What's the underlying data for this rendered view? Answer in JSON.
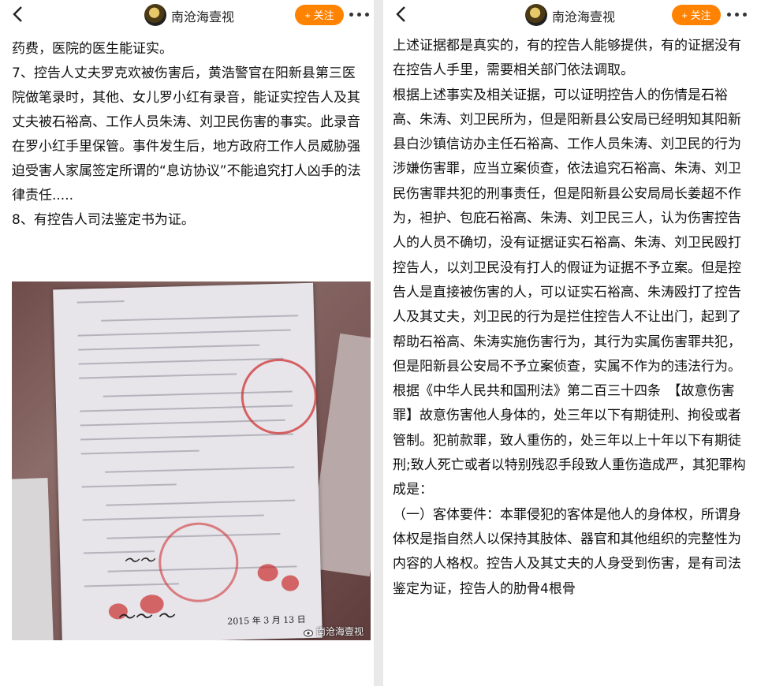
{
  "left": {
    "header": {
      "account_name": "南沧海壹视",
      "follow_label": "+ 关注"
    },
    "paragraphs": [
      "药费，医院的医生能证实。",
      "7、控告人丈夫罗克欢被伤害后，黄浩警官在阳新县第三医院做笔录时，其他、女儿罗小红有录音，能证实控告人及其丈夫被石裕高、工作人员朱涛、刘卫民伤害的事实。此录音在罗小红手里保管。事件发生后，地方政府工作人员威胁强迫受害人家属签定所谓的“息访协议”不能追究打人凶手的法律责任.....",
      "8、有控告人司法鉴定书为证。"
    ],
    "photo": {
      "watermark": "南沧海壹视",
      "date_text": "2015 年 3 月 13 日"
    }
  },
  "right": {
    "header": {
      "account_name": "南沧海壹视",
      "follow_label": "+ 关注"
    },
    "paragraphs": [
      "上述证据都是真实的，有的控告人能够提供，有的证据没有在控告人手里，需要相关部门依法调取。",
      "根据上述事实及相关证据，可以证明控告人的伤情是石裕高、朱涛、刘卫民所为，但是阳新县公安局已经明知其阳新县白沙镇信访办主任石裕高、工作人员朱涛、刘卫民的行为涉嫌伤害罪，应当立案侦查，依法追究石裕高、朱涛、刘卫民伤害罪共犯的刑事责任，但是阳新县公安局局长姜超不作为，袒护、包庇石裕高、朱涛、刘卫民三人，认为伤害控告人的人员不确切，没有证据证实石裕高、朱涛、刘卫民殴打控告人，以刘卫民没有打人的假证为证据不予立案。但是控告人是直接被伤害的人，可以证实石裕高、朱涛殴打了控告人及其丈夫，刘卫民的行为是拦住控告人不让出门，起到了帮助石裕高、朱涛实施伤害行为，其行为实属伤害罪共犯，但是阳新县公安局不予立案侦查，实属不作为的违法行为。",
      "根据《中华人民共和国刑法》第二百三十四条　【故意伤害罪】故意伤害他人身体的，处三年以下有期徒刑、拘役或者管制。犯前款罪，致人重伤的，处三年以上十年以下有期徒刑;致人死亡或者以特别残忍手段致人重伤造成严，其犯罪构成是：",
      "（一）客体要件：本罪侵犯的客体是他人的身体权，所谓身体权是指自然人以保持其肢体、器官和其他组织的完整性为内容的人格权。控告人及其丈夫的人身受到伤害，是有司法鉴定为证，控告人的肋骨4根骨"
    ]
  },
  "colors": {
    "accent": "#ff8200"
  }
}
